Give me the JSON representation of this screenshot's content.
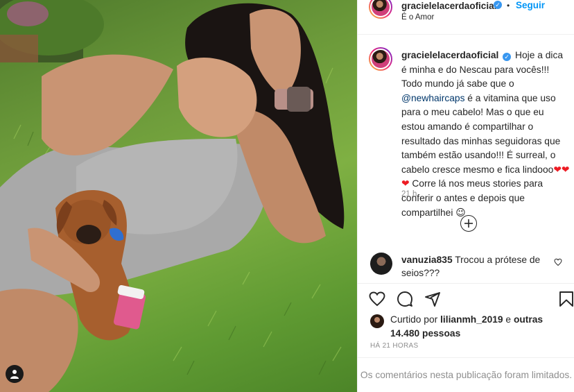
{
  "header": {
    "username": "gracielelacerdaoficial",
    "verified": true,
    "separator": "•",
    "follow_label": "Seguir",
    "location": "É o Amor",
    "more_label": "···"
  },
  "caption": {
    "username": "gracielelacerdaoficial",
    "text_1": "Hoje a dica é minha e do Nescau para vocês!!! Todo mundo já sabe que o ",
    "mention": "@newhaircaps",
    "text_2": " é a vitamina que uso para o meu cabelo! Mas o que eu estou amando é compartilhar o resultado das minhas seguidoras que também estão usando!!! É surreal, o cabelo cresce mesmo e fica lindooo",
    "hearts": "❤❤❤",
    "text_3": " Corre lá nos meus stories para conferir o antes e depois que compartilhei ",
    "emoji": "😉",
    "time": "21 h"
  },
  "comment": {
    "username": "vanuzia835",
    "text": "Trocou a prótese de seios???"
  },
  "likes": {
    "prefix": "Curtido por ",
    "user": "lilianmh_2019",
    "middle": " e ",
    "others": "outras 14.480 pessoas"
  },
  "timestamp": "HÁ 21 HORAS",
  "comments_limited": "Os comentários nesta publicação foram limitados.",
  "colors": {
    "accent_blue": "#0095f6",
    "verified_blue": "#3897f0",
    "text": "#262626",
    "muted": "#8e8e8e",
    "divider": "#efefef"
  },
  "icons": [
    "user-tag-icon",
    "verified-icon",
    "more-icon",
    "add-circle-icon",
    "heart-icon",
    "comment-icon",
    "share-icon",
    "bookmark-icon"
  ]
}
